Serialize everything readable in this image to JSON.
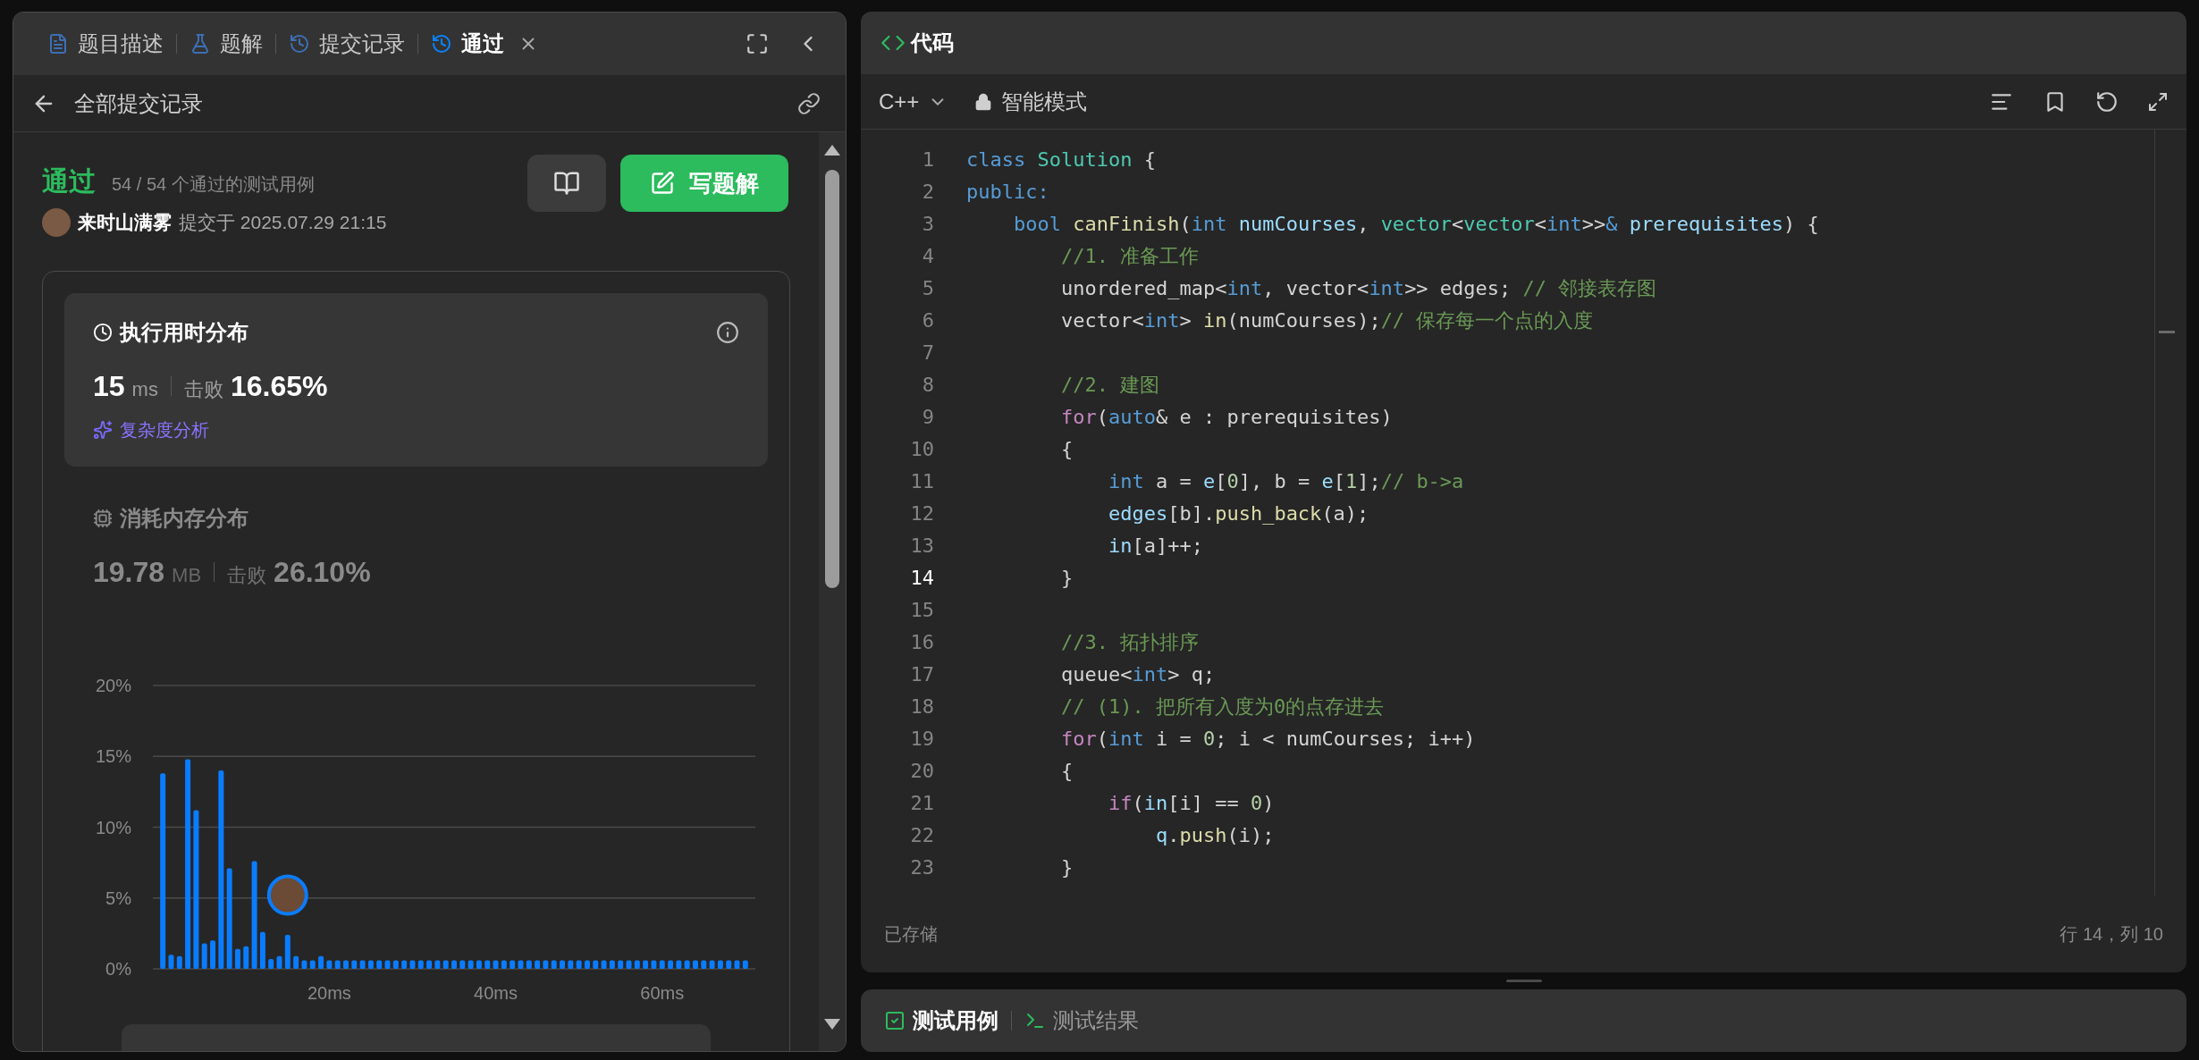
{
  "left_panel": {
    "tabs": [
      {
        "kind": "description",
        "label": "题目描述",
        "selected": false,
        "closable": false
      },
      {
        "kind": "solution",
        "label": "题解",
        "selected": false,
        "closable": false
      },
      {
        "kind": "submissions",
        "label": "提交记录",
        "selected": false,
        "closable": false
      },
      {
        "kind": "result",
        "label": "通过",
        "selected": true,
        "closable": true
      }
    ],
    "back_link": "全部提交记录",
    "submission": {
      "status": "通过",
      "cases": "54 / 54 个通过的测试用例",
      "user": "来时山满雾",
      "submitted": "提交于 2025.07.29 21:15",
      "write_button": "写题解"
    },
    "runtime": {
      "selected": true,
      "title": "执行用时分布",
      "value": "15",
      "unit": "ms",
      "beat_label": "击败",
      "beat": "16.65%",
      "analysis_link": "复杂度分析"
    },
    "memory": {
      "selected": false,
      "title": "消耗内存分布",
      "value": "19.78",
      "unit": "MB",
      "beat_label": "击败",
      "beat": "26.10%"
    },
    "chart_data": {
      "type": "bar",
      "x": [
        0,
        1,
        2,
        3,
        4,
        5,
        6,
        7,
        8,
        9,
        10,
        11,
        12,
        13,
        14,
        15,
        16,
        17,
        18,
        19,
        20,
        21,
        22,
        23,
        24,
        25,
        26,
        27,
        28,
        29,
        30,
        31,
        32,
        33,
        34,
        35,
        36,
        37,
        38,
        39,
        40,
        41,
        42,
        43,
        44,
        45,
        46,
        47,
        48,
        49,
        50,
        51,
        52,
        53,
        54,
        55,
        56,
        57,
        58,
        59,
        60,
        61,
        62,
        63,
        64,
        65,
        66,
        67,
        68,
        69,
        70
      ],
      "grid": true,
      "series": [
        {
          "color": "#0a7cff",
          "values": [
            13.8,
            1.0,
            0.9,
            14.8,
            11.2,
            1.8,
            2.0,
            14.0,
            7.1,
            1.4,
            1.6,
            7.6,
            2.6,
            0.7,
            0.9,
            2.4,
            0.9,
            0.6,
            0.6,
            0.9,
            0.6,
            0.6,
            0.6,
            0.6,
            0.6,
            0.6,
            0.6,
            0.6,
            0.6,
            0.6,
            0.6,
            0.6,
            0.6,
            0.6,
            0.6,
            0.6,
            0.6,
            0.6,
            0.6,
            0.6,
            0.6,
            0.6,
            0.6,
            0.6,
            0.6,
            0.6,
            0.6,
            0.6,
            0.6,
            0.6,
            0.6,
            0.6,
            0.6,
            0.6,
            0.6,
            0.6,
            0.6,
            0.6,
            0.6,
            0.6,
            0.6,
            0.6,
            0.6,
            0.6,
            0.6,
            0.6,
            0.6,
            0.6,
            0.6,
            0.6,
            0.6
          ]
        }
      ],
      "xlim": [
        -1.2,
        71.2
      ],
      "ylim": [
        0,
        20
      ],
      "xticks": [
        {
          "value": 20,
          "label": "20ms"
        },
        {
          "value": 40,
          "label": "40ms"
        },
        {
          "value": 60,
          "label": "60ms"
        }
      ],
      "yticks": [
        {
          "value": 0,
          "label": "0%"
        },
        {
          "value": 5,
          "label": "5%"
        },
        {
          "value": 10,
          "label": "10%"
        },
        {
          "value": 15,
          "label": "15%"
        },
        {
          "value": 20,
          "label": "20%"
        }
      ]
    }
  },
  "editor": {
    "title": "代码",
    "language": "C++",
    "mode": "智能模式",
    "lines": [
      {
        "number": "1",
        "current": false,
        "tokens": [
          {
            "kind": "keyword",
            "text": "class "
          },
          {
            "kind": "type",
            "text": "Solution"
          },
          {
            "kind": "plain",
            "text": " {"
          }
        ]
      },
      {
        "number": "2",
        "current": false,
        "tokens": [
          {
            "kind": "keyword",
            "text": "public:"
          }
        ]
      },
      {
        "number": "3",
        "current": false,
        "tokens": [
          {
            "kind": "keyword",
            "text": "    bool "
          },
          {
            "kind": "function",
            "text": "canFinish"
          },
          {
            "kind": "plain",
            "text": "("
          },
          {
            "kind": "keyword",
            "text": "int "
          },
          {
            "kind": "variable",
            "text": "numCourses"
          },
          {
            "kind": "plain",
            "text": ", "
          },
          {
            "kind": "type",
            "text": "vector"
          },
          {
            "kind": "plain",
            "text": "<"
          },
          {
            "kind": "type",
            "text": "vector"
          },
          {
            "kind": "plain",
            "text": "<"
          },
          {
            "kind": "keyword",
            "text": "int"
          },
          {
            "kind": "plain",
            "text": ">>"
          },
          {
            "kind": "keyword",
            "text": "& "
          },
          {
            "kind": "variable",
            "text": "prerequisites"
          },
          {
            "kind": "plain",
            "text": ") {"
          }
        ]
      },
      {
        "number": "4",
        "current": false,
        "tokens": [
          {
            "kind": "comment",
            "text": "        //1. 准备工作"
          }
        ]
      },
      {
        "number": "5",
        "current": false,
        "tokens": [
          {
            "kind": "plain",
            "text": "        unordered_map<"
          },
          {
            "kind": "keyword",
            "text": "int"
          },
          {
            "kind": "plain",
            "text": ", vector<"
          },
          {
            "kind": "keyword",
            "text": "int"
          },
          {
            "kind": "plain",
            "text": ">> edges; "
          },
          {
            "kind": "comment",
            "text": "// 邻接表存图"
          }
        ]
      },
      {
        "number": "6",
        "current": false,
        "tokens": [
          {
            "kind": "plain",
            "text": "        vector<"
          },
          {
            "kind": "keyword",
            "text": "int"
          },
          {
            "kind": "plain",
            "text": "> "
          },
          {
            "kind": "function",
            "text": "in"
          },
          {
            "kind": "plain",
            "text": "(numCourses);"
          },
          {
            "kind": "comment",
            "text": "// 保存每一个点的入度"
          }
        ]
      },
      {
        "number": "7",
        "current": false
      },
      {
        "number": "8",
        "current": false,
        "tokens": [
          {
            "kind": "comment",
            "text": "        //2. 建图"
          }
        ]
      },
      {
        "number": "9",
        "current": false,
        "tokens": [
          {
            "kind": "control",
            "text": "        for"
          },
          {
            "kind": "plain",
            "text": "("
          },
          {
            "kind": "keyword",
            "text": "auto"
          },
          {
            "kind": "plain",
            "text": "& e : prerequisites)"
          }
        ]
      },
      {
        "number": "10",
        "current": false,
        "tokens": [
          {
            "kind": "plain",
            "text": "        {"
          }
        ]
      },
      {
        "number": "11",
        "current": false,
        "tokens": [
          {
            "kind": "keyword",
            "text": "            int"
          },
          {
            "kind": "plain",
            "text": " a = "
          },
          {
            "kind": "variable",
            "text": "e"
          },
          {
            "kind": "plain",
            "text": "["
          },
          {
            "kind": "number",
            "text": "0"
          },
          {
            "kind": "plain",
            "text": "], b = "
          },
          {
            "kind": "variable",
            "text": "e"
          },
          {
            "kind": "plain",
            "text": "["
          },
          {
            "kind": "number",
            "text": "1"
          },
          {
            "kind": "plain",
            "text": "];"
          },
          {
            "kind": "comment",
            "text": "// b->a"
          }
        ]
      },
      {
        "number": "12",
        "current": false,
        "tokens": [
          {
            "kind": "variable",
            "text": "            edges"
          },
          {
            "kind": "plain",
            "text": "[b]."
          },
          {
            "kind": "function",
            "text": "push_back"
          },
          {
            "kind": "plain",
            "text": "(a);"
          }
        ]
      },
      {
        "number": "13",
        "current": false,
        "tokens": [
          {
            "kind": "variable",
            "text": "            in"
          },
          {
            "kind": "plain",
            "text": "[a]++;"
          }
        ]
      },
      {
        "number": "14",
        "current": true,
        "tokens": [
          {
            "kind": "plain",
            "text": "        }"
          }
        ]
      },
      {
        "number": "15",
        "current": false
      },
      {
        "number": "16",
        "current": false,
        "tokens": [
          {
            "kind": "comment",
            "text": "        //3. 拓扑排序"
          }
        ]
      },
      {
        "number": "17",
        "current": false,
        "tokens": [
          {
            "kind": "plain",
            "text": "        queue<"
          },
          {
            "kind": "keyword",
            "text": "int"
          },
          {
            "kind": "plain",
            "text": "> q;"
          }
        ]
      },
      {
        "number": "18",
        "current": false,
        "tokens": [
          {
            "kind": "comment",
            "text": "        // (1). 把所有入度为0的点存进去"
          }
        ]
      },
      {
        "number": "19",
        "current": false,
        "tokens": [
          {
            "kind": "control",
            "text": "        for"
          },
          {
            "kind": "plain",
            "text": "("
          },
          {
            "kind": "keyword",
            "text": "int"
          },
          {
            "kind": "plain",
            "text": " i = "
          },
          {
            "kind": "number",
            "text": "0"
          },
          {
            "kind": "plain",
            "text": "; i < numCourses; i++)"
          }
        ]
      },
      {
        "number": "20",
        "current": false,
        "tokens": [
          {
            "kind": "plain",
            "text": "        {"
          }
        ]
      },
      {
        "number": "21",
        "current": false,
        "tokens": [
          {
            "kind": "control",
            "text": "            if"
          },
          {
            "kind": "plain",
            "text": "("
          },
          {
            "kind": "variable",
            "text": "in"
          },
          {
            "kind": "plain",
            "text": "[i] == "
          },
          {
            "kind": "number",
            "text": "0"
          },
          {
            "kind": "plain",
            "text": ")"
          }
        ]
      },
      {
        "number": "22",
        "current": false,
        "tokens": [
          {
            "kind": "variable",
            "text": "                q"
          },
          {
            "kind": "plain",
            "text": "."
          },
          {
            "kind": "function",
            "text": "push"
          },
          {
            "kind": "plain",
            "text": "(i);"
          }
        ]
      },
      {
        "number": "23",
        "current": false,
        "tokens": [
          {
            "kind": "plain",
            "text": "        }"
          }
        ]
      }
    ],
    "status": "已存储",
    "cursor": "行 14，列 10"
  },
  "bottom_panel": {
    "tabs": [
      {
        "kind": "testcase",
        "label": "测试用例",
        "selected": true
      },
      {
        "kind": "result",
        "label": "测试结果",
        "selected": false
      }
    ]
  }
}
